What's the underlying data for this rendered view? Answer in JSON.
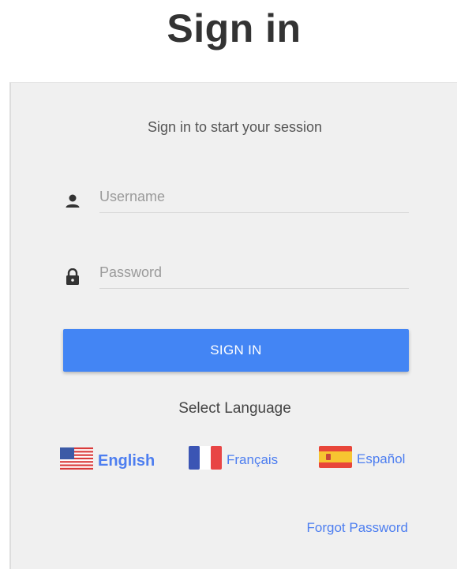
{
  "page": {
    "title": "Sign in"
  },
  "login": {
    "message": "Sign in to start your session",
    "username_placeholder": "Username",
    "password_placeholder": "Password",
    "signin_label": "SIGN IN",
    "select_language_label": "Select Language",
    "forgot_password_label": "Forgot Password"
  },
  "languages": [
    {
      "label": "English",
      "icon": "us-flag-icon",
      "selected": true
    },
    {
      "label": "Français",
      "icon": "france-flag-icon",
      "selected": false
    },
    {
      "label": "Español",
      "icon": "spain-flag-icon",
      "selected": false
    }
  ],
  "colors": {
    "accent": "#4385f4",
    "link": "#4d7ef0",
    "panel_background": "#f0f0f0"
  }
}
